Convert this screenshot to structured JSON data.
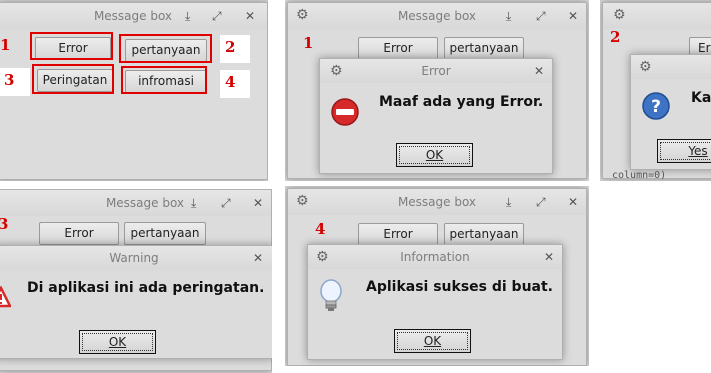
{
  "colors": {
    "annotation": "#e00000",
    "titlebar_text": "#7d7d7d",
    "window_bg": "#dcdcdc"
  },
  "panel1": {
    "title": "Message box",
    "buttons": {
      "error": "Error",
      "question": "pertanyaan",
      "warning": "Peringatan",
      "info": "infromasi"
    },
    "numbers": [
      "1",
      "2",
      "3",
      "4"
    ]
  },
  "panel2": {
    "bg_title": "Message box",
    "number": "1",
    "buttons": {
      "error": "Error",
      "question": "pertanyaan"
    },
    "dialog": {
      "title": "Error",
      "message": "Maaf ada yang Error.",
      "ok": "OK",
      "icon": "error-icon"
    }
  },
  "panel3": {
    "number": "2",
    "button_partial": "Ern",
    "dialog": {
      "message_partial": "Ka",
      "yes": "Yes",
      "icon": "question-icon"
    },
    "code_snippet": "column=0)"
  },
  "panel4": {
    "bg_title": "Message box",
    "number": "3",
    "buttons": {
      "error": "Error",
      "question": "pertanyaan"
    },
    "dialog": {
      "title": "Warning",
      "message": "Di aplikasi ini ada peringatan.",
      "ok": "OK",
      "icon": "warning-icon"
    }
  },
  "panel5": {
    "bg_title": "Message box",
    "number": "4",
    "buttons": {
      "error": "Error",
      "question": "pertanyaan"
    },
    "dialog": {
      "title": "Information",
      "message": "Aplikasi sukses di buat.",
      "ok": "OK",
      "icon": "lightbulb-icon"
    }
  }
}
